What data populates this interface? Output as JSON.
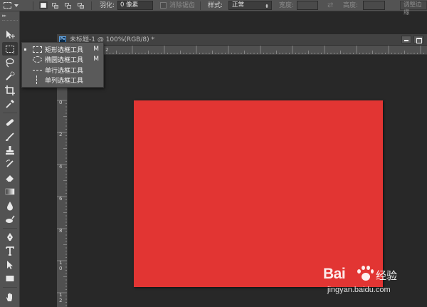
{
  "options_bar": {
    "feather_label": "羽化:",
    "feather_value": "0 像素",
    "antialias_label": "消除锯齿",
    "style_label": "样式:",
    "style_value": "正常",
    "width_label": "宽度:",
    "height_label": "高度:",
    "refine_edge_label": "调整边缘"
  },
  "document": {
    "tab_title": "未标题-1 @ 100%(RGB/8) *",
    "app_icon_text": "Ps",
    "canvas_color": "#e23533"
  },
  "rulers": {
    "top_labels": [
      "2"
    ],
    "left_labels": [
      "0",
      "2",
      "4",
      "6",
      "8",
      "1\n0",
      "1\n2"
    ]
  },
  "flyout": {
    "items": [
      {
        "label": "矩形选框工具",
        "shortcut": "M",
        "icon": "rect-marquee-icon",
        "selected": true
      },
      {
        "label": "椭圆选框工具",
        "shortcut": "M",
        "icon": "ellipse-marquee-icon",
        "selected": false
      },
      {
        "label": "单行选框工具",
        "shortcut": "",
        "icon": "single-row-marquee-icon",
        "selected": false
      },
      {
        "label": "单列选框工具",
        "shortcut": "",
        "icon": "single-column-marquee-icon",
        "selected": false
      }
    ]
  },
  "toolbox": {
    "tools": [
      "move-tool",
      "rect-marquee-tool",
      "lasso-tool",
      "quick-selection-tool",
      "crop-tool",
      "eyedropper-tool",
      "healing-brush-tool",
      "brush-tool",
      "clone-stamp-tool",
      "history-brush-tool",
      "eraser-tool",
      "gradient-tool",
      "blur-tool",
      "dodge-tool",
      "pen-tool",
      "type-tool",
      "path-selection-tool",
      "rectangle-shape-tool",
      "hand-tool"
    ]
  },
  "watermark": {
    "brand": "Bai",
    "brand2": "经验",
    "url": "jingyan.baidu.com"
  }
}
